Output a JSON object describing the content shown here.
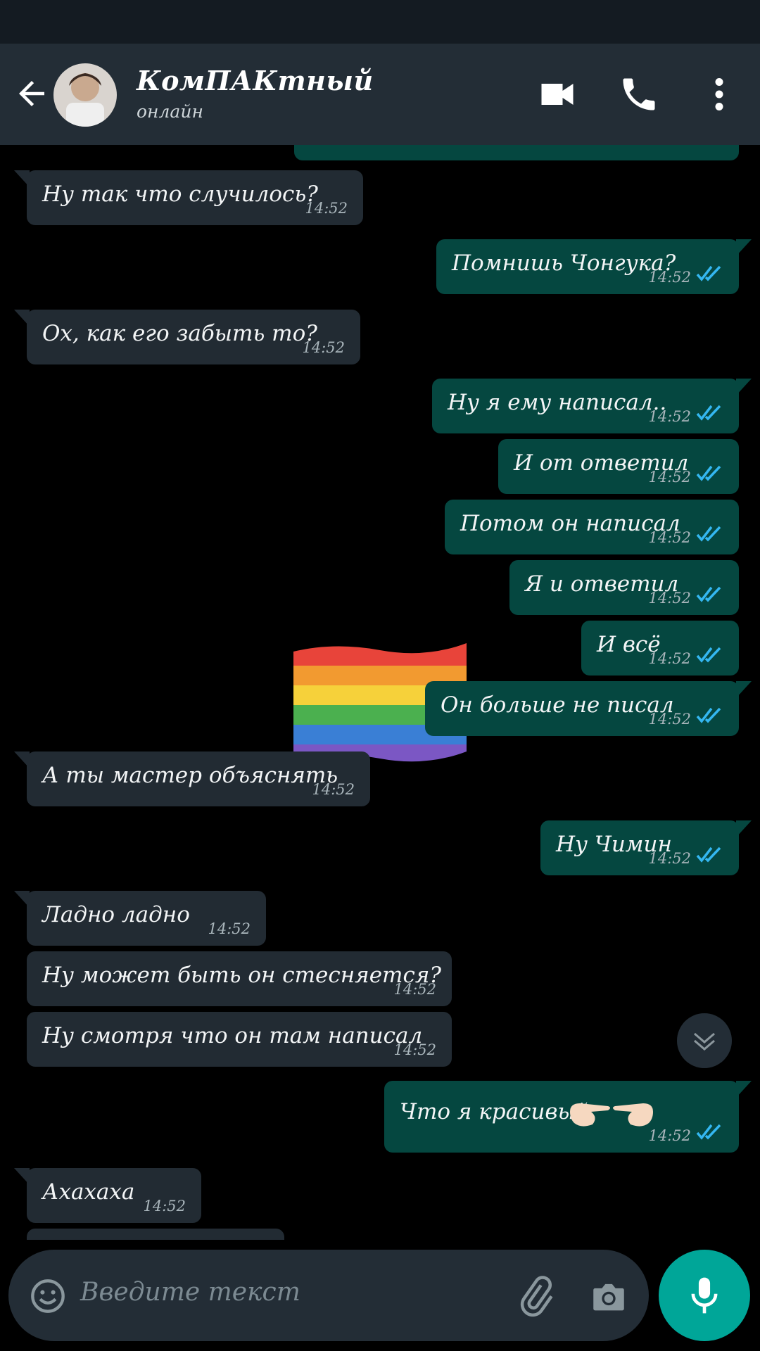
{
  "header": {
    "contact_name": "КомПАКтный",
    "contact_status": "онлайн"
  },
  "messages": [
    {
      "dir": "in",
      "text": "Ну так что случилось?",
      "time": "14:52"
    },
    {
      "dir": "out",
      "text": "Помнишь Чонгука?",
      "time": "14:52"
    },
    {
      "dir": "in",
      "text": "Ох, как его забыть то?",
      "time": "14:52"
    },
    {
      "dir": "out",
      "text": "Ну я ему написал..",
      "time": "14:52"
    },
    {
      "dir": "out",
      "text": "И от ответил",
      "time": "14:52"
    },
    {
      "dir": "out",
      "text": "Потом он написал",
      "time": "14:52"
    },
    {
      "dir": "out",
      "text": "Я и ответил",
      "time": "14:52"
    },
    {
      "dir": "out",
      "text": "И всё",
      "time": "14:52"
    },
    {
      "dir": "out",
      "text": "Он больше не писал",
      "time": "14:52"
    },
    {
      "dir": "in",
      "text": "А ты мастер объяснять",
      "time": "14:52"
    },
    {
      "dir": "out",
      "text": "Ну Чимин",
      "time": "14:52"
    },
    {
      "dir": "in",
      "text": "Ладно ладно",
      "time": "14:52"
    },
    {
      "dir": "in",
      "text": "Ну может быть он стесняется?",
      "time": "14:52"
    },
    {
      "dir": "in",
      "text": "Ну смотря что он там написал",
      "time": "14:52"
    },
    {
      "dir": "out",
      "text": "Что я красивый",
      "time": "14:52"
    },
    {
      "dir": "in",
      "text": "Ахахаха",
      "time": "14:52"
    }
  ],
  "input": {
    "placeholder": "Введите текст"
  },
  "colors": {
    "header": "#232d36",
    "incoming_bubble": "#222b33",
    "outgoing_bubble": "#054740",
    "read_ticks": "#34b7f1",
    "mic_button": "#00a698"
  },
  "icons": [
    "back-arrow-icon",
    "video-call-icon",
    "phone-icon",
    "more-vertical-icon",
    "double-check-icon",
    "chevron-down-icon",
    "emoji-icon",
    "paperclip-icon",
    "camera-icon",
    "microphone-icon",
    "rainbow-flag-icon"
  ]
}
